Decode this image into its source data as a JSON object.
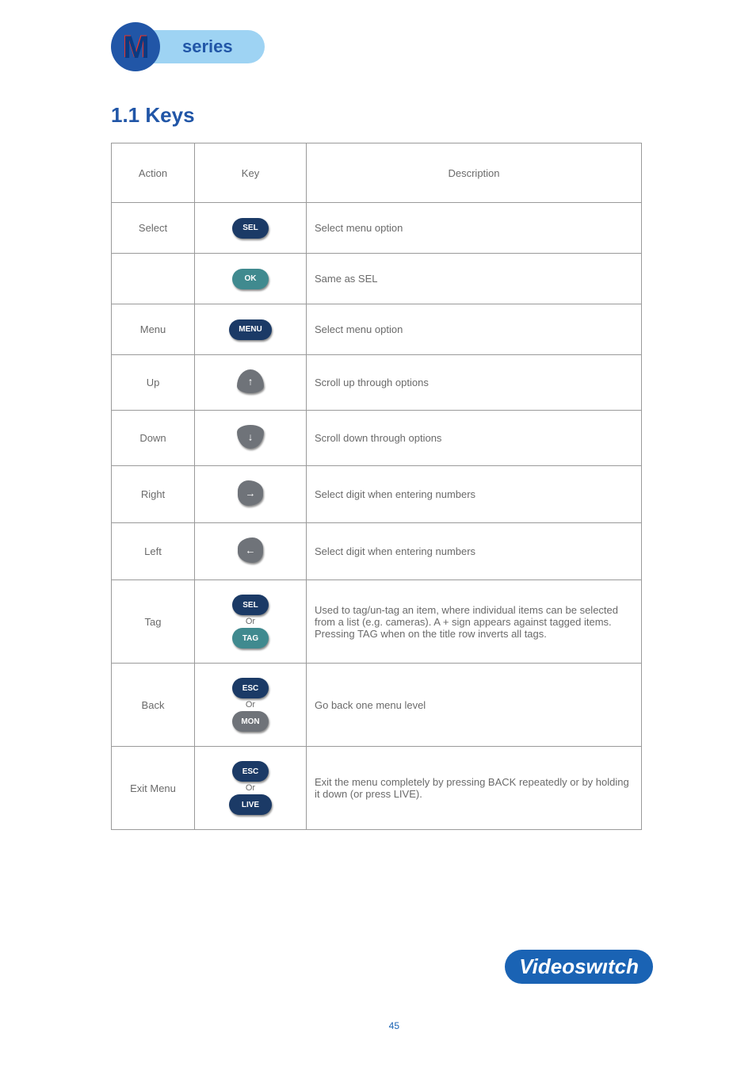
{
  "logo": {
    "series_text": "series",
    "m": "M"
  },
  "section_title": "1.1  Keys",
  "table": {
    "headers": [
      "Action",
      "Key",
      "Description"
    ],
    "rows": [
      {
        "action": "Select",
        "btn": "SEL",
        "style": "navy",
        "desc": "Select menu option"
      },
      {
        "action": "",
        "btn": "OK",
        "style": "teal",
        "desc": "Same as SEL"
      },
      {
        "action": "Menu",
        "btn": "MENU",
        "style": "navy",
        "desc": "Select menu option"
      },
      {
        "action": "Up",
        "btn": "↑",
        "style": "arrow-up",
        "desc": "Scroll up through options"
      },
      {
        "action": "Down",
        "btn": "↓",
        "style": "arrow-down",
        "desc": "Scroll down through options"
      },
      {
        "action": "Right",
        "btn": "→",
        "style": "arrow-right",
        "desc": "Select digit when entering numbers"
      },
      {
        "action": "Left",
        "btn": "←",
        "style": "arrow-left",
        "desc": "Select digit when entering numbers"
      },
      {
        "action": "Tag",
        "btn": "SEL",
        "style": "navy",
        "or_label": "Or",
        "or_btn": "TAG",
        "or_style": "teal",
        "desc": "Used to tag/un-tag an item, where individual items can be selected from a list (e.g.  cameras).  A + sign appears against tagged items. Pressing TAG when on the title  row inverts all tags."
      },
      {
        "action": "Back",
        "btn": "ESC",
        "style": "navy",
        "or_label": "Or",
        "or_btn": "MON",
        "or_style": "gray",
        "desc": "Go back one menu level"
      },
      {
        "action": "Exit Menu",
        "btn": "ESC",
        "style": "navy",
        "or_label": "Or",
        "or_btn": "LIVE",
        "or_style": "navy",
        "desc": "Exit the menu completely by pressing BACK repeatedly or by holding it down (or  press LIVE).",
        "class": "tall"
      }
    ]
  },
  "footer": {
    "brand": "Videoswıtch",
    "page": "45"
  }
}
